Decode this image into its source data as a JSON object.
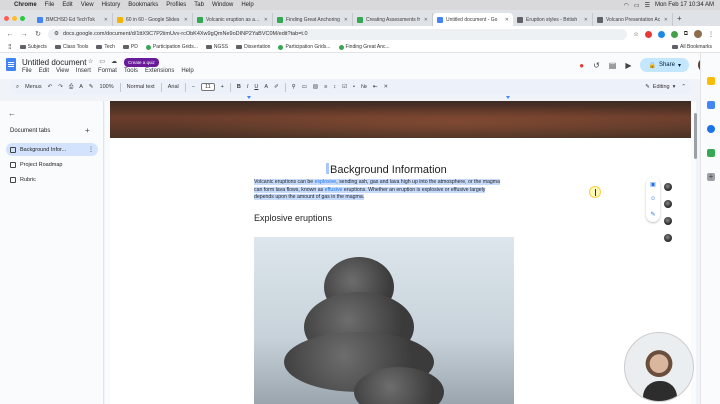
{
  "mac_menubar": {
    "app": "Chrome",
    "items": [
      "File",
      "Edit",
      "View",
      "History",
      "Bookmarks",
      "Profiles",
      "Tab",
      "Window",
      "Help"
    ],
    "clock": "Mon Feb 17 10:34 AM"
  },
  "browser_tabs": [
    {
      "label": "BMCHSD Ed TechTok",
      "color": "#4285f4"
    },
    {
      "label": "60 in 60 - Google Slides",
      "color": "#f4b400"
    },
    {
      "label": "Volcanic eruption as an a",
      "color": "#34a853"
    },
    {
      "label": "Finding Great Anchoring",
      "color": "#34a853"
    },
    {
      "label": "Creating Assessments fr",
      "color": "#34a853"
    },
    {
      "label": "Untitled document - Go",
      "color": "#4285f4",
      "active": true
    },
    {
      "label": "Eruption styles - British",
      "color": "#5f6368"
    },
    {
      "label": "Volcano Presentation Ac",
      "color": "#5f6368"
    }
  ],
  "address": {
    "url": "docs.google.com/document/d/1ttX9C7P2iimUvv-rcObK4Xw9gQmNe9oDINP2YaBVC0M/edit?tab=t.0"
  },
  "bookmarks": [
    {
      "label": "Subjects",
      "type": "folder"
    },
    {
      "label": "Class Tools",
      "type": "folder"
    },
    {
      "label": "Tech",
      "type": "folder"
    },
    {
      "label": "PD",
      "type": "folder"
    },
    {
      "label": "Participation Grids...",
      "type": "link"
    },
    {
      "label": "NGSS",
      "type": "folder"
    },
    {
      "label": "Dissertation",
      "type": "folder"
    },
    {
      "label": "Participation Grids...",
      "type": "link"
    },
    {
      "label": "Finding Great Anc...",
      "type": "link"
    }
  ],
  "bookmarks_all": "All Bookmarks",
  "docs": {
    "title": "Untitled document",
    "quiz_button": "Create a quiz",
    "menu": [
      "File",
      "Edit",
      "View",
      "Insert",
      "Format",
      "Tools",
      "Extensions",
      "Help"
    ],
    "share_label": "Share"
  },
  "toolbar": {
    "menus": "Menus",
    "zoom": "100%",
    "style": "Normal text",
    "font": "Arial",
    "font_size": "11",
    "mode": "Editing"
  },
  "sidebar": {
    "heading": "Document tabs",
    "tabs": [
      {
        "label": "Background Infor...",
        "active": true
      },
      {
        "label": "Project Roadmap"
      },
      {
        "label": "Rubric"
      }
    ]
  },
  "document": {
    "heading": "Background Information",
    "para_1": "Volcanic eruptions can be ",
    "para_kw1": "explosive",
    "para_2": ", sending ash, gas and lava high up into the atmosphere, or the magma can form lava flows, known as ",
    "para_kw2": "effusive",
    "para_3": " eruptions. Whether an eruption is explosive or effusive largely depends upon the amount of gas in the magma.",
    "subheading": "Explosive eruptions"
  }
}
